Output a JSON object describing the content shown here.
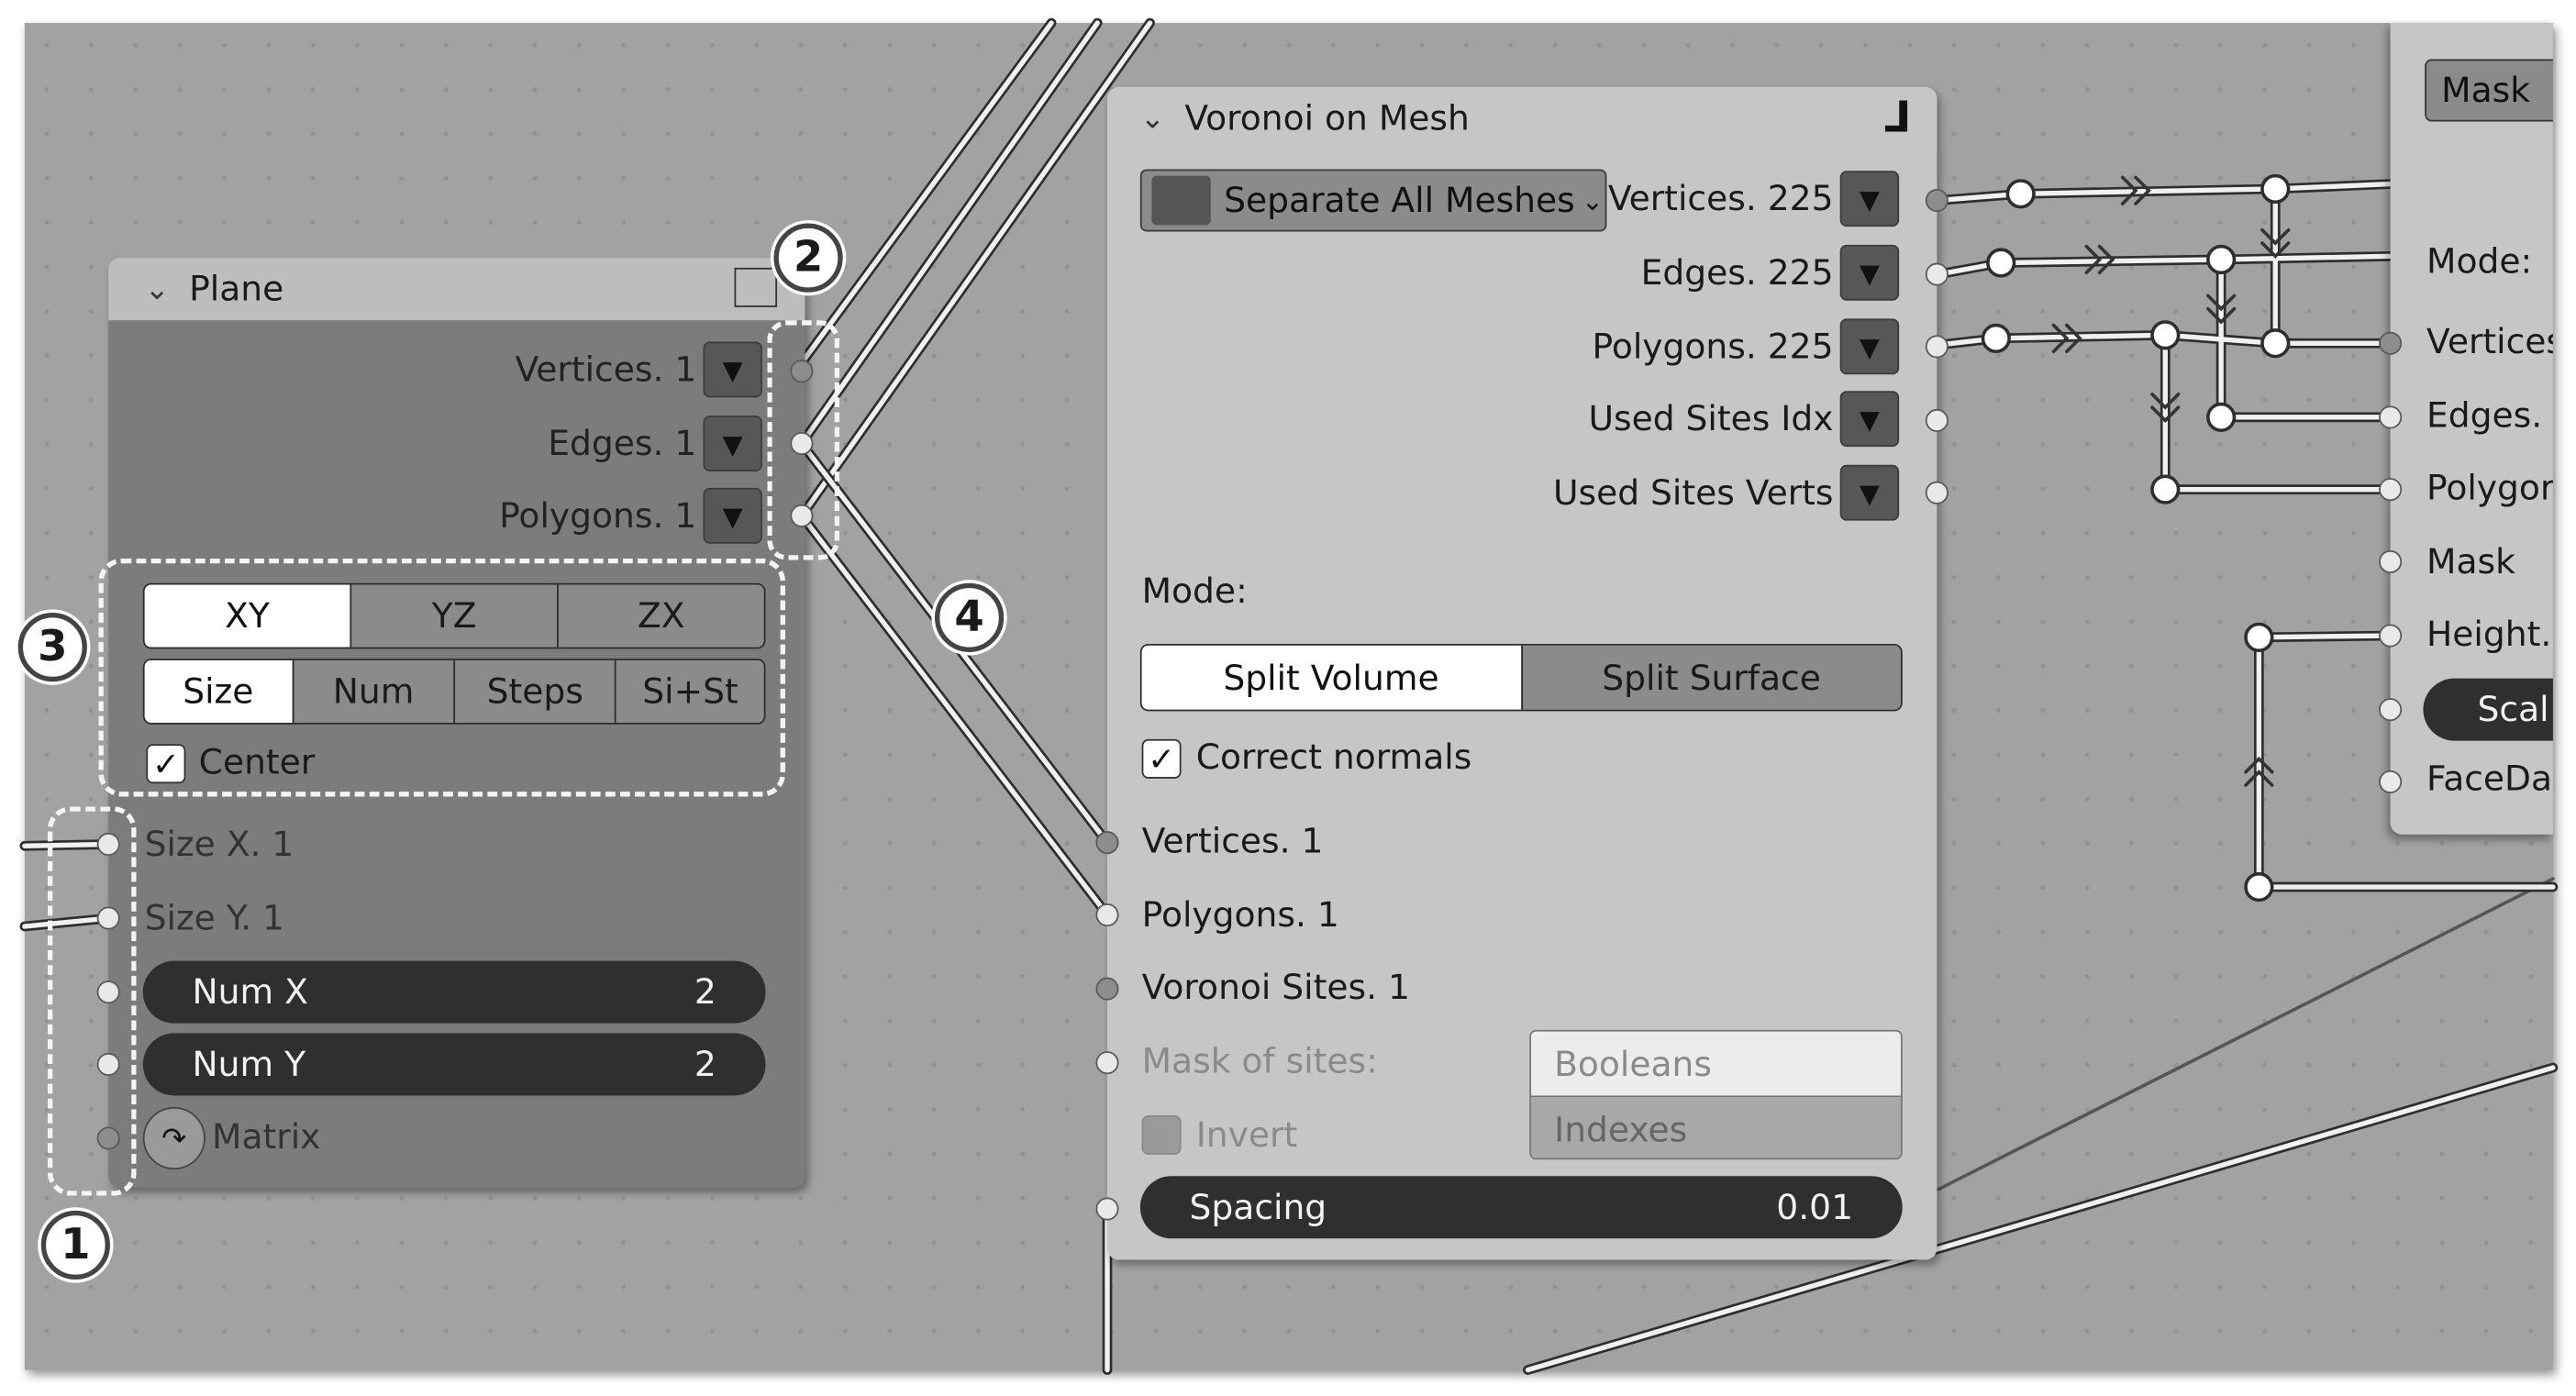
{
  "plane_node": {
    "title": "Plane",
    "outputs": [
      "Vertices. 1",
      "Edges. 1",
      "Polygons. 1"
    ],
    "axis_options": [
      "XY",
      "YZ",
      "ZX"
    ],
    "axis_selected": "XY",
    "mode_options": [
      "Size",
      "Num",
      "Steps",
      "Si+St"
    ],
    "mode_selected": "Size",
    "center_label": "Center",
    "center_checked": true,
    "inputs": [
      "Size X. 1",
      "Size Y. 1"
    ],
    "num_x": {
      "label": "Num X",
      "value": "2"
    },
    "num_y": {
      "label": "Num Y",
      "value": "2"
    },
    "matrix_label": "Matrix"
  },
  "voronoi_node": {
    "title": "Voronoi on Mesh",
    "mode_dropdown": "Separate All Meshes",
    "outputs": [
      "Vertices. 225",
      "Edges. 225",
      "Polygons. 225",
      "Used Sites Idx",
      "Used Sites Verts"
    ],
    "mode_label": "Mode:",
    "split_options": [
      "Split Volume",
      "Split Surface"
    ],
    "split_selected": "Split Volume",
    "correct_normals_label": "Correct normals",
    "correct_normals_checked": true,
    "inputs": [
      "Vertices. 1",
      "Polygons. 1",
      "Voronoi Sites. 1"
    ],
    "mask_label": "Mask of sites:",
    "mask_options": [
      "Booleans",
      "Indexes"
    ],
    "invert_label": "Invert",
    "spacing": {
      "label": "Spacing",
      "value": "0.01"
    }
  },
  "right_node": {
    "mask_button": "Mask",
    "mode_label": "Mode:",
    "inputs": [
      "Vertices",
      "Edges.",
      "Polygor",
      "Mask",
      "Height.",
      "FaceDa"
    ],
    "scale_label": "Scal"
  },
  "callouts": [
    "1",
    "2",
    "3",
    "4"
  ],
  "colors": {
    "canvas": "#a2a2a2",
    "plane_header": "#bdbdbd",
    "plane_body": "#7c7c7c",
    "voronoi_body": "#c6c6c6",
    "wire": "#f0f0f0"
  }
}
